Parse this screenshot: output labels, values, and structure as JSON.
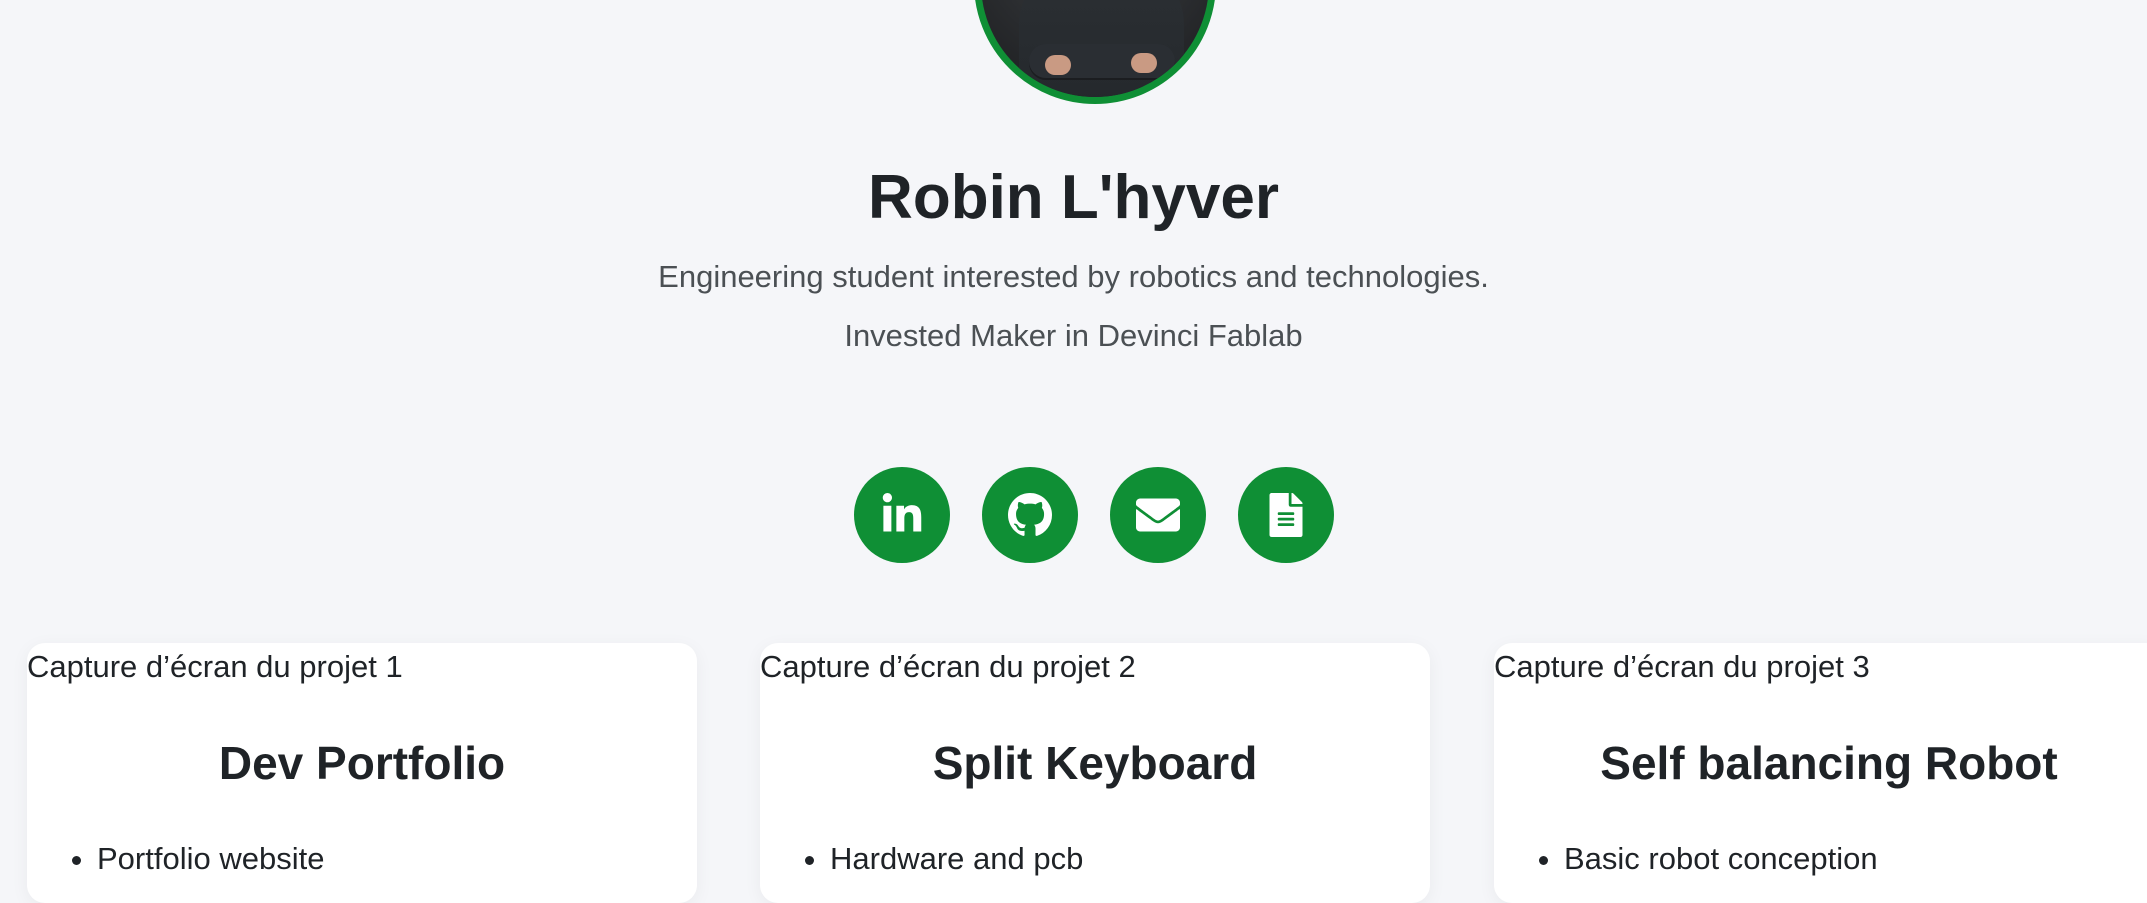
{
  "profile": {
    "name": "Robin L'hyver",
    "tagline_1": "Engineering student interested by robotics and technologies.",
    "tagline_2": "Invested Maker in Devinci Fablab",
    "accent_color": "#0f8f35"
  },
  "socials": [
    {
      "name": "LinkedIn",
      "icon": "linkedin-icon"
    },
    {
      "name": "GitHub",
      "icon": "github-icon"
    },
    {
      "name": "Email",
      "icon": "envelope-icon"
    },
    {
      "name": "Resume",
      "icon": "document-icon"
    }
  ],
  "projects": [
    {
      "image_alt": "Capture d’écran du projet 1",
      "title": "Dev Portfolio",
      "bullets": [
        "Portfolio website"
      ]
    },
    {
      "image_alt": "Capture d’écran du projet 2",
      "title": "Split Keyboard",
      "bullets": [
        "Hardware and pcb"
      ]
    },
    {
      "image_alt": "Capture d’écran du projet 3",
      "title": "Self balancing Robot",
      "bullets": [
        "Basic robot conception"
      ]
    }
  ]
}
